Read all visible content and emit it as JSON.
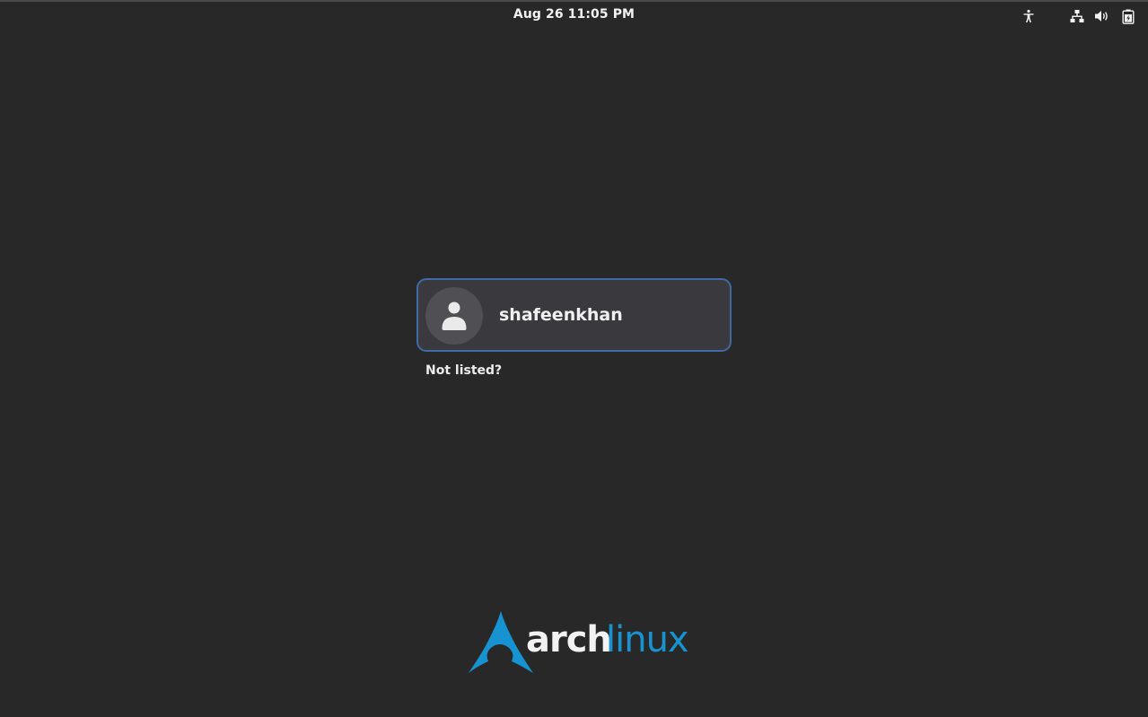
{
  "top_bar": {
    "datetime": "Aug 26  11:05 PM",
    "tray": [
      {
        "name": "accessibility-icon"
      },
      {
        "name": "network-icon"
      },
      {
        "name": "volume-icon"
      },
      {
        "name": "battery-icon"
      }
    ]
  },
  "user_list": {
    "users": [
      {
        "username": "shafeenkhan",
        "avatar_icon": "user-icon"
      }
    ],
    "not_listed_label": "Not listed?"
  },
  "branding": {
    "logo": {
      "part1": "arch",
      "part2": "linux",
      "icon": "arch-logo-icon"
    }
  },
  "colors": {
    "background": "#282828",
    "accent_border": "#3f6aa6",
    "arch_blue": "#1793d1",
    "card": "#3a3a3e"
  }
}
